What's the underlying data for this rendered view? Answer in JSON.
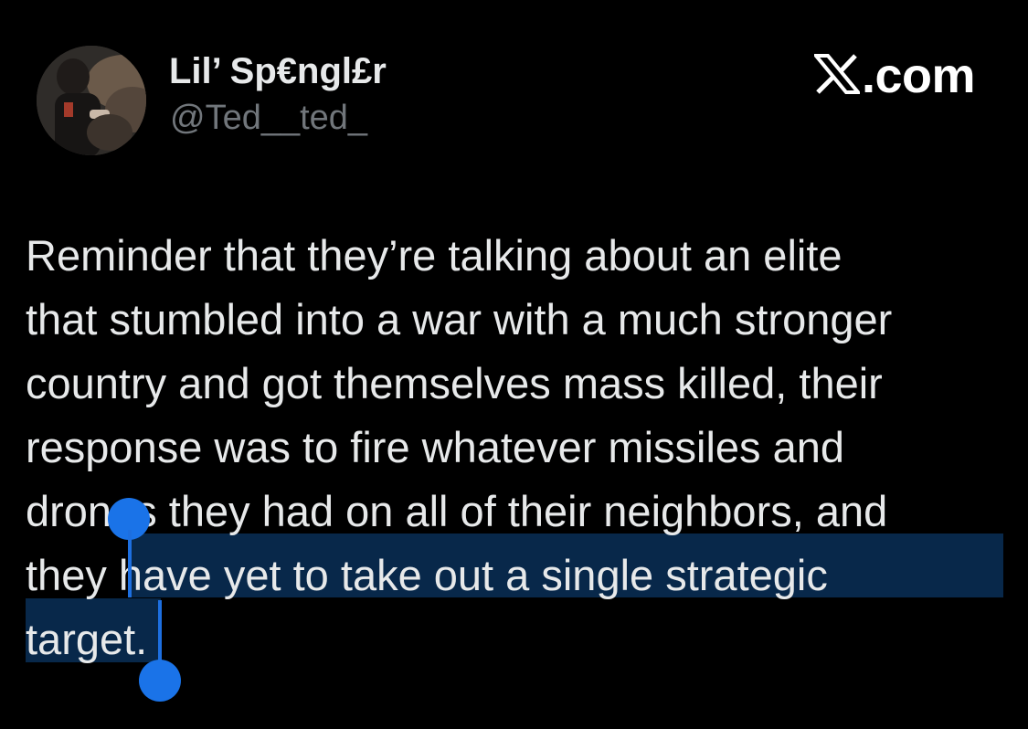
{
  "author": {
    "display_name": "Lil’ Sp€ngl£r",
    "handle": "@Ted__ted_"
  },
  "brand": {
    "label": ".com",
    "icon": "x-logo-icon"
  },
  "tweet": {
    "lines": [
      "Reminder that they’re talking about an elite",
      "that stumbled into a war with a much stronger",
      "country and got themselves mass killed, their",
      "response was to fire whatever missiles and",
      "drones they had on all of their neighbors, and",
      "they have yet to take out a single strategic",
      "target."
    ],
    "selected_text": "have yet to take out a single strategic target."
  },
  "colors": {
    "background": "#000000",
    "text": "#e7e9ea",
    "handle_text": "#71767b",
    "selection_highlight": "#08284a",
    "selection_handles": "#1a73e8"
  }
}
